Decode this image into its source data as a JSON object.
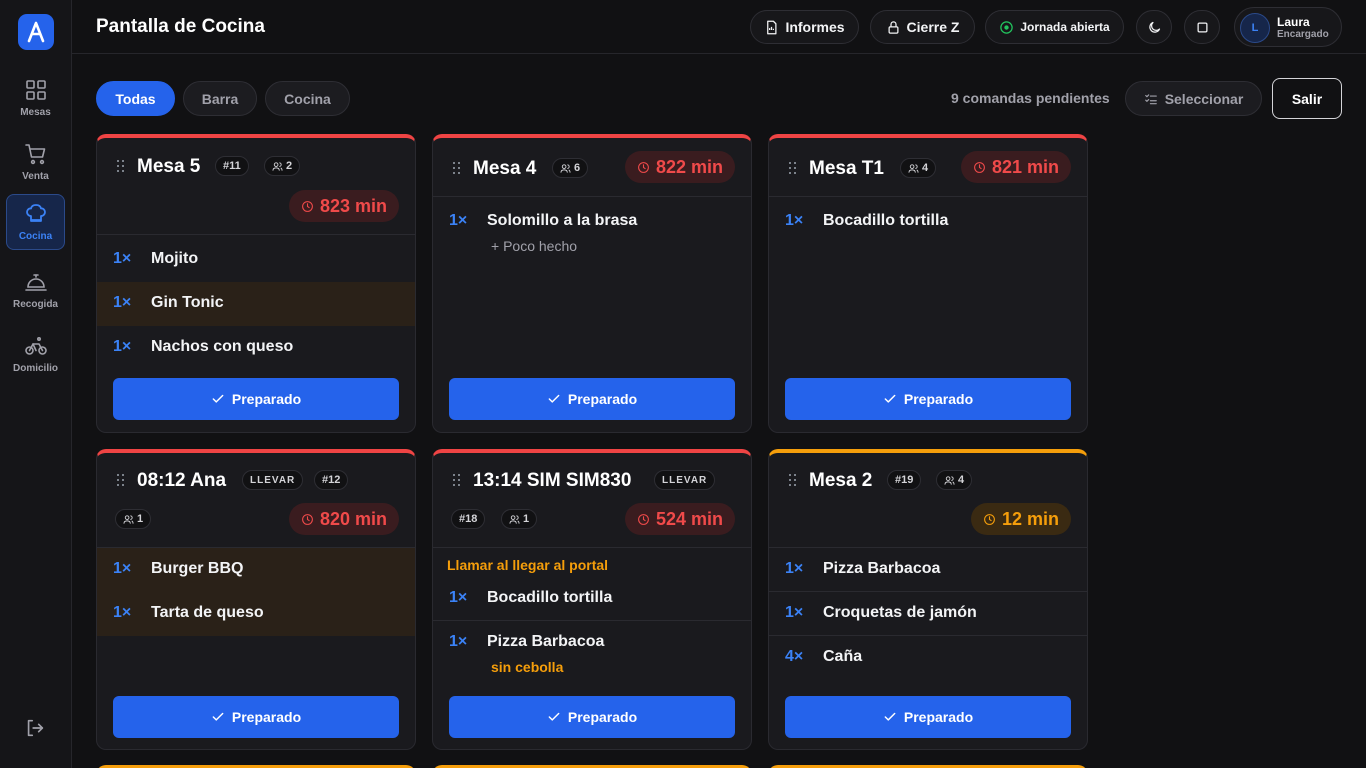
{
  "app": {
    "title": "Pantalla de Cocina"
  },
  "sidebar": {
    "items": [
      {
        "label": "Mesas",
        "icon": "grid-icon"
      },
      {
        "label": "Venta",
        "icon": "cart-icon"
      },
      {
        "label": "Cocina",
        "icon": "chef-hat-icon"
      },
      {
        "label": "Recogida",
        "icon": "bell-icon"
      },
      {
        "label": "Domicilio",
        "icon": "bicycle-icon"
      }
    ]
  },
  "header": {
    "reports_label": "Informes",
    "close_label": "Cierre Z",
    "shift_label": "Jornada abierta",
    "user": {
      "initial": "L",
      "name": "Laura",
      "role": "Encargado"
    }
  },
  "filters": {
    "tabs": [
      "Todas",
      "Barra",
      "Cocina"
    ],
    "pending_text": "9 comandas pendientes",
    "select_label": "Seleccionar",
    "exit_label": "Salir"
  },
  "orders": [
    {
      "title": "Mesa 5",
      "number": "#11",
      "guests": "2",
      "timer": "823 min",
      "items": [
        {
          "qty": "1×",
          "name": "Mojito"
        },
        {
          "qty": "1×",
          "name": "Gin Tonic"
        },
        {
          "qty": "1×",
          "name": "Nachos con queso"
        }
      ],
      "button": "Preparado"
    },
    {
      "title": "Mesa 4",
      "guests": "6",
      "timer": "822 min",
      "items": [
        {
          "qty": "1×",
          "name": "Solomillo a la brasa",
          "modifier": "+ Poco hecho"
        }
      ],
      "button": "Preparado"
    },
    {
      "title": "Mesa T1",
      "guests": "4",
      "timer": "821 min",
      "items": [
        {
          "qty": "1×",
          "name": "Bocadillo tortilla"
        }
      ],
      "button": "Preparado"
    },
    {
      "title": "08:12 Ana",
      "tag": "LLEVAR",
      "number": "#12",
      "guests": "1",
      "timer": "820 min",
      "items": [
        {
          "qty": "1×",
          "name": "Burger BBQ"
        },
        {
          "qty": "1×",
          "name": "Tarta de queso"
        }
      ],
      "button": "Preparado"
    },
    {
      "title": "13:14 SIM SIM830",
      "tag": "LLEVAR",
      "number": "#18",
      "guests": "1",
      "timer": "524 min",
      "note": "Llamar al llegar al portal",
      "items": [
        {
          "qty": "1×",
          "name": "Bocadillo tortilla"
        },
        {
          "qty": "1×",
          "name": "Pizza Barbacoa",
          "modifier": "sin cebolla"
        }
      ],
      "button": "Preparado"
    },
    {
      "title": "Mesa 2",
      "number": "#19",
      "guests": "4",
      "timer": "12 min",
      "items": [
        {
          "qty": "1×",
          "name": "Pizza Barbacoa"
        },
        {
          "qty": "1×",
          "name": "Croquetas de jamón"
        },
        {
          "qty": "4×",
          "name": "Caña"
        }
      ],
      "button": "Preparado"
    }
  ],
  "colors": {
    "accent": "#2563eb",
    "late": "#ef4444",
    "warning": "#f59e0b",
    "background": "#111113"
  }
}
